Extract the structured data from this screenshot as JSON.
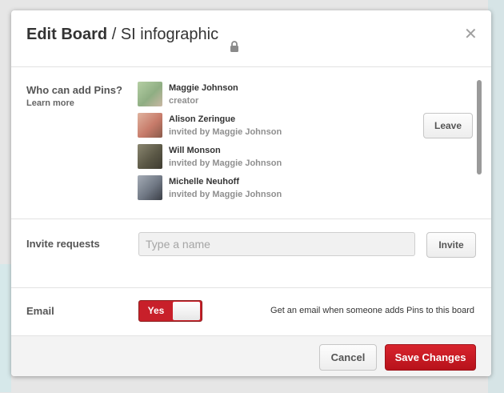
{
  "header": {
    "title_bold": "Edit Board",
    "title_rest": "SI infographic",
    "lock_icon": "lock-icon",
    "close_glyph": "✕"
  },
  "collaborators": {
    "label": "Who can add Pins?",
    "learn_more": "Learn more",
    "leave_label": "Leave",
    "members": [
      {
        "name": "Maggie Johnson",
        "role": "creator",
        "avatar_color": "#a9c39a"
      },
      {
        "name": "Alison Zeringue",
        "role": "invited by Maggie Johnson",
        "avatar_color": "#d39a86"
      },
      {
        "name": "Will Monson",
        "role": "invited by Maggie Johnson",
        "avatar_color": "#6f6b58"
      },
      {
        "name": "Michelle Neuhoff",
        "role": "invited by Maggie Johnson",
        "avatar_color": "#88909c"
      }
    ]
  },
  "invite": {
    "label": "Invite requests",
    "placeholder": "Type a name",
    "button_label": "Invite"
  },
  "email": {
    "label": "Email",
    "toggle_value": "Yes",
    "note": "Get an email when someone adds Pins to this board"
  },
  "footer": {
    "cancel_label": "Cancel",
    "save_label": "Save Changes"
  },
  "colors": {
    "accent_red": "#c8202a",
    "text_dark": "#333333"
  }
}
